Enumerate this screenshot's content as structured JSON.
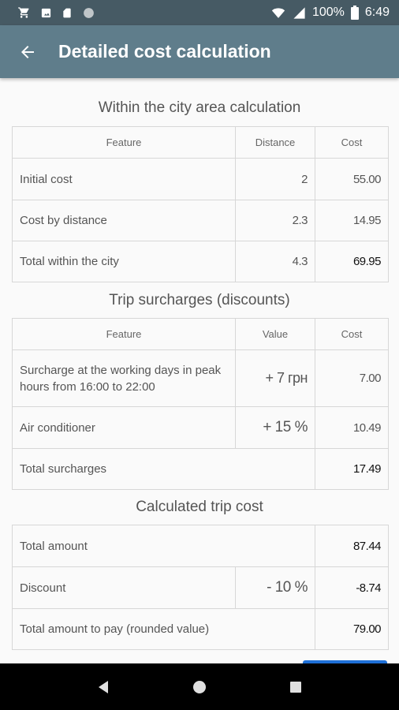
{
  "status_bar": {
    "battery_text": "100%",
    "time": "6:49",
    "icons": [
      "cart-icon",
      "photo-icon",
      "sim-card-icon",
      "circle-icon",
      "wifi-icon",
      "signal-icon",
      "battery-icon"
    ]
  },
  "app_bar": {
    "title": "Detailed cost calculation",
    "back_icon": "arrow-back-icon"
  },
  "city": {
    "title": "Within the city area calculation",
    "headers": [
      "Feature",
      "Distance",
      "Cost"
    ],
    "rows": [
      {
        "feature": "Initial cost",
        "distance": "2",
        "cost": "55.00"
      },
      {
        "feature": "Cost by distance",
        "distance": "2.3",
        "cost": "14.95"
      },
      {
        "feature": "Total within the city",
        "distance": "4.3",
        "cost": "69.95"
      }
    ]
  },
  "surcharges": {
    "title": "Trip surcharges (discounts)",
    "headers": [
      "Feature",
      "Value",
      "Cost"
    ],
    "rows": [
      {
        "feature": "Surcharge at the working days in peak hours from 16:00 to 22:00",
        "value": "+ 7 грн",
        "cost": "7.00"
      },
      {
        "feature": "Air conditioner",
        "value": "+ 15 %",
        "cost": "10.49"
      }
    ],
    "total": {
      "feature": "Total surcharges",
      "cost": "17.49"
    }
  },
  "trip_cost": {
    "title": "Calculated trip cost",
    "total_amount": {
      "feature": "Total amount",
      "cost": "87.44"
    },
    "discount": {
      "feature": "Discount",
      "value": "- 10 %",
      "cost": "-8.74"
    },
    "to_pay": {
      "feature": "Total amount to pay (rounded value)",
      "cost": "79.00"
    }
  },
  "colors": {
    "status_bar": "#465a64",
    "app_bar": "#5f7d8b",
    "accent": "#1e6fd6"
  },
  "nav_bar": {
    "icons": [
      "back-triangle-icon",
      "home-circle-icon",
      "recents-square-icon"
    ]
  }
}
